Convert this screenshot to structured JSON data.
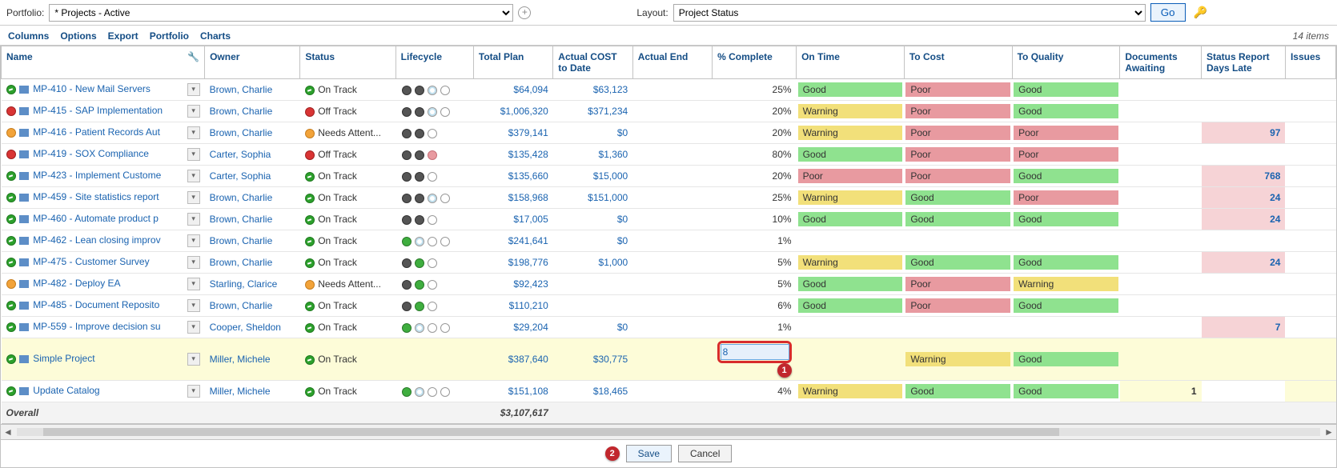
{
  "topbar": {
    "portfolio_label": "Portfolio:",
    "portfolio_value": "* Projects - Active",
    "layout_label": "Layout:",
    "layout_value": "Project Status",
    "go_label": "Go"
  },
  "menu": {
    "columns": "Columns",
    "options": "Options",
    "export": "Export",
    "portfolio": "Portfolio",
    "charts": "Charts",
    "items_count": "14 items"
  },
  "columns": {
    "name": "Name",
    "owner": "Owner",
    "status": "Status",
    "lifecycle": "Lifecycle",
    "total_plan": "Total Plan",
    "actual_cost": "Actual COST to Date",
    "actual_end": "Actual End",
    "pct_complete": "% Complete",
    "on_time": "On Time",
    "to_cost": "To Cost",
    "to_quality": "To Quality",
    "docs": "Documents Awaiting",
    "status_report": "Status Report Days Late",
    "issues": "Issues"
  },
  "status_labels": {
    "on_track": "On Track",
    "off_track": "Off Track",
    "needs": "Needs Attent..."
  },
  "rag": {
    "good": "Good",
    "warning": "Warning",
    "poor": "Poor"
  },
  "rows": [
    {
      "name": "MP-410 - New Mail Servers",
      "owner": "Brown, Charlie",
      "status": "on_track",
      "life": "dd_o",
      "plan": "$64,094",
      "cost": "$63,123",
      "pct": "25%",
      "on": "good",
      "toc": "poor",
      "toq": "good",
      "late": "",
      "issues": "",
      "ind": "green"
    },
    {
      "name": "MP-415 - SAP Implementation",
      "owner": "Brown, Charlie",
      "status": "off_track",
      "life": "dd_o",
      "plan": "$1,006,320",
      "cost": "$371,234",
      "pct": "20%",
      "on": "warning",
      "toc": "poor",
      "toq": "good",
      "late": "",
      "issues": "",
      "ind": "red"
    },
    {
      "name": "MP-416 - Patient Records Aut",
      "owner": "Brown, Charlie",
      "status": "needs",
      "life": "ddoc",
      "plan": "$379,141",
      "cost": "$0",
      "pct": "20%",
      "on": "warning",
      "toc": "poor",
      "toq": "poor",
      "late": "97",
      "issues": "",
      "ind": "orange"
    },
    {
      "name": "MP-419 - SOX Compliance",
      "owner": "Carter, Sophia",
      "status": "off_track",
      "life": "ddpc",
      "plan": "$135,428",
      "cost": "$1,360",
      "pct": "80%",
      "on": "good",
      "toc": "poor",
      "toq": "poor",
      "late": "",
      "issues": "",
      "ind": "red"
    },
    {
      "name": "MP-423 - Implement Custome",
      "owner": "Carter, Sophia",
      "status": "on_track",
      "life": "ddoc",
      "plan": "$135,660",
      "cost": "$15,000",
      "pct": "20%",
      "on": "poor",
      "toc": "poor",
      "toq": "good",
      "late": "768",
      "issues": "",
      "ind": "green"
    },
    {
      "name": "MP-459 - Site statistics report",
      "owner": "Brown, Charlie",
      "status": "on_track",
      "life": "dd_o",
      "plan": "$158,968",
      "cost": "$151,000",
      "pct": "25%",
      "on": "warning",
      "toc": "good",
      "toq": "poor",
      "late": "24",
      "issues": "",
      "ind": "green"
    },
    {
      "name": "MP-460 - Automate product p",
      "owner": "Brown, Charlie",
      "status": "on_track",
      "life": "ddoc",
      "plan": "$17,005",
      "cost": "$0",
      "pct": "10%",
      "on": "good",
      "toc": "good",
      "toq": "good",
      "late": "24",
      "issues": "",
      "ind": "green"
    },
    {
      "name": "MP-462 - Lean closing improv",
      "owner": "Brown, Charlie",
      "status": "on_track",
      "life": "g_oo",
      "plan": "$241,641",
      "cost": "$0",
      "pct": "1%",
      "on": "",
      "toc": "",
      "toq": "",
      "late": "",
      "issues": "",
      "ind": "green"
    },
    {
      "name": "MP-475 - Customer Survey",
      "owner": "Brown, Charlie",
      "status": "on_track",
      "life": "dgoc",
      "plan": "$198,776",
      "cost": "$1,000",
      "pct": "5%",
      "on": "warning",
      "toc": "good",
      "toq": "good",
      "late": "24",
      "issues": "",
      "ind": "green"
    },
    {
      "name": "MP-482 - Deploy EA",
      "owner": "Starling, Clarice",
      "status": "needs",
      "life": "dgoc",
      "plan": "$92,423",
      "cost": "",
      "pct": "5%",
      "on": "good",
      "toc": "poor",
      "toq": "warning",
      "late": "",
      "issues": "",
      "ind": "orange"
    },
    {
      "name": "MP-485 - Document Reposito",
      "owner": "Brown, Charlie",
      "status": "on_track",
      "life": "dgoc",
      "plan": "$110,210",
      "cost": "",
      "pct": "6%",
      "on": "good",
      "toc": "poor",
      "toq": "good",
      "late": "",
      "issues": "",
      "ind": "green"
    },
    {
      "name": "MP-559 - Improve decision su",
      "owner": "Cooper, Sheldon",
      "status": "on_track",
      "life": "g_ooc",
      "plan": "$29,204",
      "cost": "$0",
      "pct": "1%",
      "on": "",
      "toc": "",
      "toq": "",
      "late": "7",
      "issues": "",
      "ind": "green"
    },
    {
      "name": "Simple Project",
      "owner": "Miller, Michele",
      "status": "on_track",
      "life": "",
      "plan": "$387,640",
      "cost": "$30,775",
      "pct": "edit",
      "on": "",
      "toc": "warning",
      "toq": "good",
      "late": "",
      "issues": "",
      "ind": "green",
      "highlight": true,
      "edit_value": "8"
    },
    {
      "name": "Update Catalog",
      "owner": "Miller, Michele",
      "status": "on_track",
      "life": "g_ooc",
      "plan": "$151,108",
      "cost": "$18,465",
      "pct": "4%",
      "on": "warning",
      "toc": "good",
      "toq": "good",
      "late": "",
      "issues": "",
      "ind": "green",
      "docs": "1"
    }
  ],
  "overall": {
    "label": "Overall",
    "total": "$3,107,617"
  },
  "footer": {
    "save": "Save",
    "cancel": "Cancel"
  },
  "callouts": {
    "c1": "1",
    "c2": "2"
  }
}
